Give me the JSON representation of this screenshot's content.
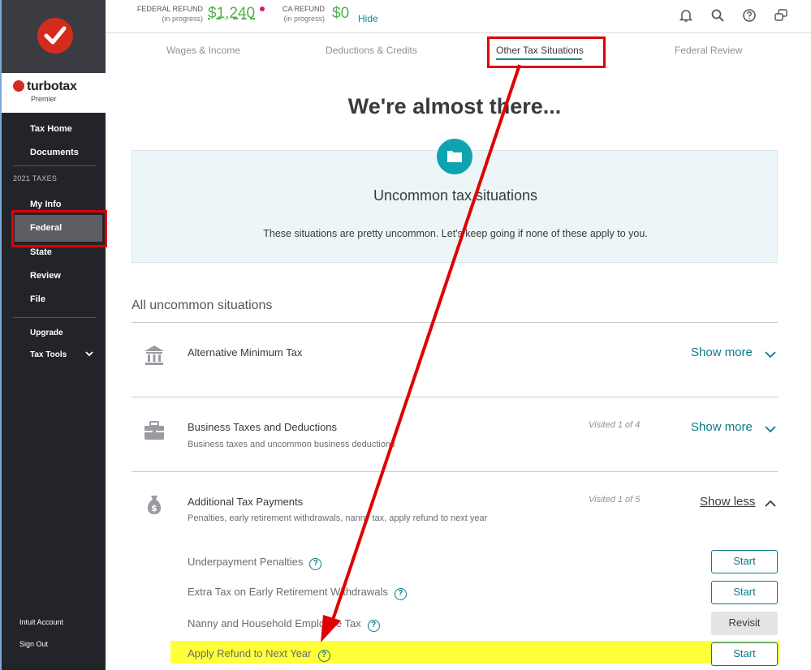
{
  "brand": {
    "name": "turbotax",
    "edition": "Premier"
  },
  "sidebar": {
    "items_top": [
      "Tax Home",
      "Documents"
    ],
    "section_label": "2021 TAXES",
    "items_taxes": [
      "My Info",
      "Federal",
      "State",
      "Review",
      "File"
    ],
    "items_bottom": [
      "Upgrade",
      "Tax Tools"
    ],
    "footer": [
      "Intuit Account",
      "Sign Out"
    ]
  },
  "header": {
    "federal_label": "FEDERAL REFUND",
    "federal_sub": "(in progress)",
    "federal_amount": "$1,240",
    "ca_label": "CA REFUND",
    "ca_sub": "(in progress)",
    "ca_amount": "$0",
    "hide": "Hide",
    "icons": [
      "bell-icon",
      "search-icon",
      "help-icon",
      "chat-icon"
    ]
  },
  "tabs": [
    "Wages & Income",
    "Deductions & Credits",
    "Other Tax Situations",
    "Federal Review"
  ],
  "main": {
    "title": "We're almost there...",
    "card_title": "Uncommon tax situations",
    "card_desc": "These situations are pretty uncommon. Let's keep going if none of these apply to you.",
    "section_heading": "All uncommon situations"
  },
  "rows": [
    {
      "title": "Alternative Minimum Tax",
      "sub": "",
      "visited": "",
      "toggle": "Show more"
    },
    {
      "title": "Business Taxes and Deductions",
      "sub": "Business taxes and uncommon business deductions",
      "visited": "Visited 1 of 4",
      "toggle": "Show more"
    },
    {
      "title": "Additional Tax Payments",
      "sub": "Penalties, early retirement withdrawals, nanny tax, apply refund to next year",
      "visited": "Visited 1 of 5",
      "toggle": "Show less"
    }
  ],
  "sub_items": [
    {
      "label": "Underpayment Penalties",
      "action": "Start"
    },
    {
      "label": "Extra Tax on Early Retirement Withdrawals",
      "action": "Start"
    },
    {
      "label": "Nanny and Household Employee Tax",
      "action": "Revisit"
    },
    {
      "label": "Apply Refund to Next Year",
      "action": "Start"
    }
  ],
  "help_glyph": "?",
  "colors": {
    "accent": "#0a7a87",
    "highlight": "#ffff3a",
    "annotation": "#e00000",
    "refund_green": "#52b14d"
  }
}
